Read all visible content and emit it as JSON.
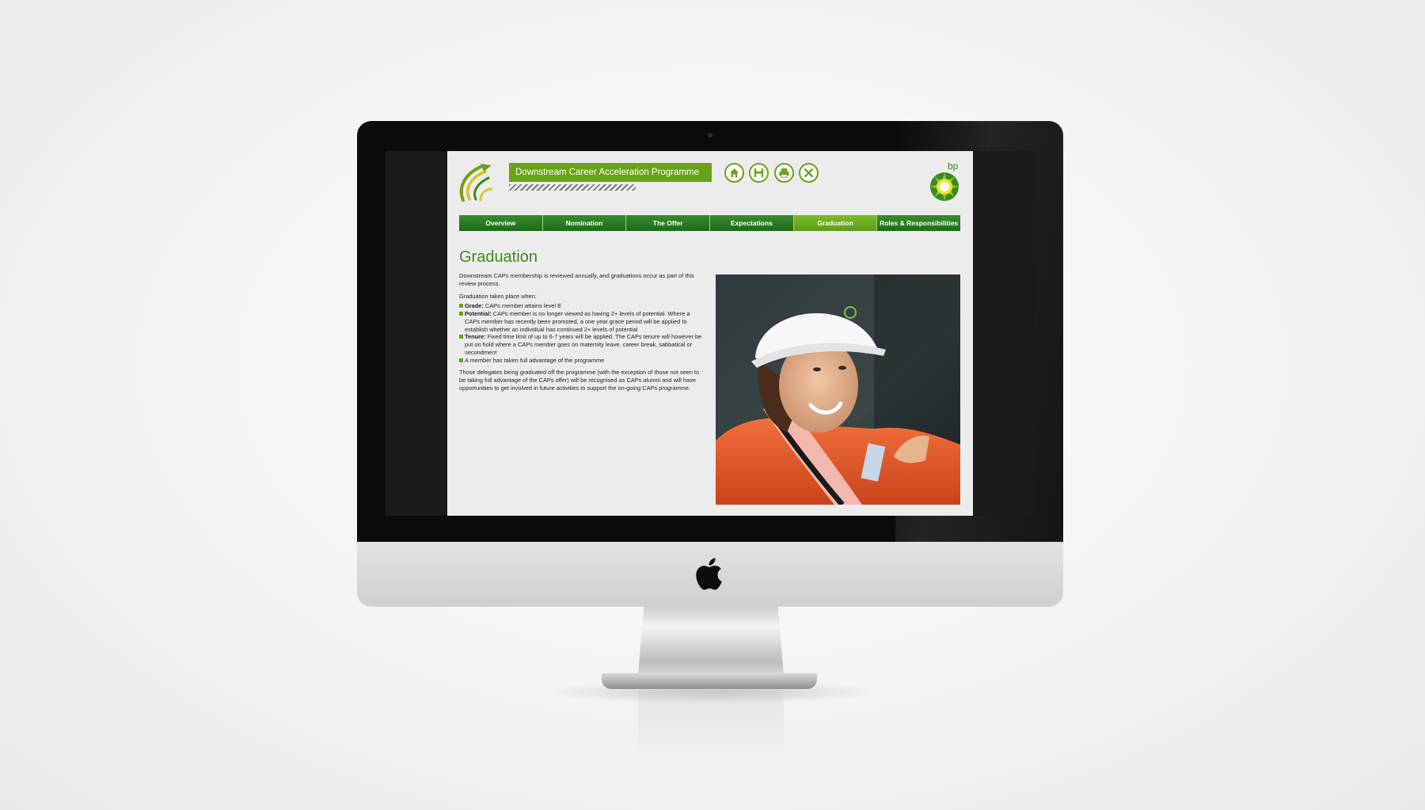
{
  "app": {
    "title": "Downstream Career Acceleration Programme",
    "brand": "bp"
  },
  "toolbar": [
    {
      "name": "home-button",
      "icon": "home-icon"
    },
    {
      "name": "save-button",
      "icon": "save-icon"
    },
    {
      "name": "print-button",
      "icon": "print-icon"
    },
    {
      "name": "close-button",
      "icon": "close-icon"
    }
  ],
  "nav": {
    "tabs": [
      {
        "label": "Overview",
        "active": false
      },
      {
        "label": "Nomination",
        "active": false
      },
      {
        "label": "The Offer",
        "active": false
      },
      {
        "label": "Expectations",
        "active": false
      },
      {
        "label": "Graduation",
        "active": true
      },
      {
        "label": "Roles & Responsibilities",
        "active": false
      }
    ]
  },
  "main": {
    "heading": "Graduation",
    "intro": "Downstream CAPs membership is reviewed annually, and graduations occur as part of this review process.",
    "list_intro": "Graduation takes place when:",
    "criteria": [
      {
        "term": "Grade:",
        "text": " CAPs member attains level E"
      },
      {
        "term": "Potential:",
        "text": " CAPs member is no longer viewed as having 2+ levels of potential. Where a CAPs member has recently been promoted, a one year grace period will be applied to establish whether an individual has continued 2+ levels of potential"
      },
      {
        "term": "Tenure:",
        "text": " Fixed time limit of up to 6-7 years will be applied. The CAPs tenure will however be put on hold where a CAPs member goes on maternity leave, career break, sabbatical or secondment"
      },
      {
        "term": "",
        "text": "A member has taken full advantage of the programme"
      }
    ],
    "closing": "Those delegates being graduated off the programme (with the exception of those not seen to be taking full advantage of the CAPs offer) will be recognised as CAPs alumni and will have opportunities to get involved in future activities to support the on-going CAPs programme."
  },
  "colors": {
    "accent": "#6aa219",
    "nav_green": "#1c6b1a",
    "heading_green": "#3a8a1c"
  }
}
